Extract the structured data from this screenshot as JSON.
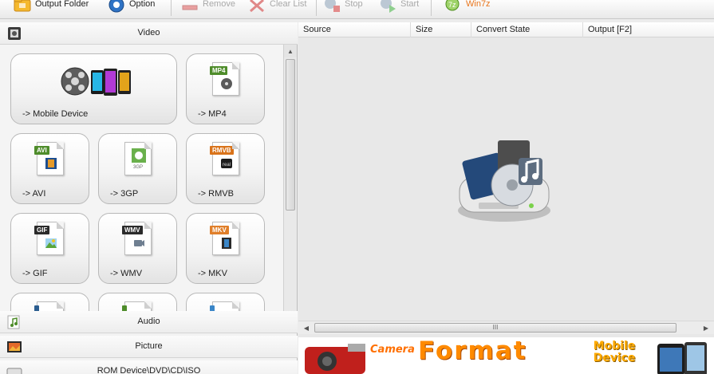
{
  "toolbar": {
    "output_folder": "Output Folder",
    "option": "Option",
    "remove": "Remove",
    "clear_list": "Clear List",
    "stop": "Stop",
    "start": "Start",
    "win7z": "Win7z"
  },
  "categories": {
    "video": "Video",
    "audio": "Audio",
    "picture": "Picture",
    "rom": "ROM Device\\DVD\\CD\\ISO"
  },
  "video_tiles": {
    "mobile": "-> Mobile Device",
    "mp4": "-> MP4",
    "avi": "-> AVI",
    "3gp": "-> 3GP",
    "rmvb": "-> RMVB",
    "gif": "-> GIF",
    "wmv": "-> WMV",
    "mkv": "-> MKV"
  },
  "tags": {
    "mp4": "MP4",
    "avi": "AVI",
    "rmvb": "RMVB",
    "gif": "GIF",
    "wmv": "WMV",
    "mkv": "MKV",
    "g3p": "3GP"
  },
  "table_columns": {
    "source": "Source",
    "size": "Size",
    "convert_state": "Convert State",
    "output": "Output [F2]"
  },
  "banner": {
    "camera": "Camera",
    "format": "Format",
    "mobile": "Mobile Device"
  },
  "colors": {
    "accent_orange": "#ff8a00",
    "tag_green": "#4e8c2a",
    "tag_orange": "#d9731a"
  }
}
